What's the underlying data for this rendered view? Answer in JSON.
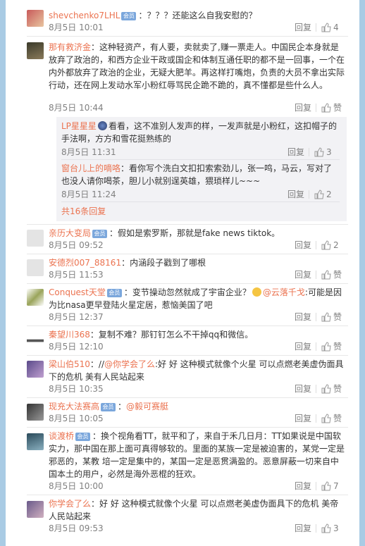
{
  "comments": [
    {
      "name": "shevchenko7LHL",
      "vip": true,
      "text": "：？？？还能这么自我安慰的？",
      "time": "8月5日 10:01",
      "reply": "回复",
      "like": "4"
    },
    {
      "name": "那有救济金",
      "vip": false,
      "text": "：这种轻资产，有人要，卖就卖了,赚一票走人。中国民企本身就是放弃了政治的，和西方企业干政或国企和体制互通任职的都不是一回事，一个在内外都放弃了政治的企业，无疑大肥羊。再这样打嘴炮，负责的大员不拿出实际行动，还在网上发动水军小粉红辱骂民企跪不跪的，真不懂都是些什么人。",
      "time": "8月5日 10:44",
      "reply": "回复",
      "like": "赞"
    },
    {
      "name": "亲历大变局",
      "vip": true,
      "text": "：假如是索罗斯，那就是fake news tiktok。",
      "time": "8月5日 09:52",
      "reply": "回复",
      "like": "2"
    },
    {
      "name": "安德烈007_88161",
      "vip": false,
      "text": "：内涵段子戳到了哪根",
      "time": "8月5日 11:53",
      "reply": "回复",
      "like": "赞"
    },
    {
      "name": "Conquest天堂",
      "vip": true,
      "text_a": "：变节操动忽然就成了宇宙企业？",
      "mention": "@云落千戈",
      "text_b": ":可能是因为比nasa更早登陆火星定居，惹恼美国了吧",
      "time": "8月5日 12:37",
      "reply": "回复",
      "like": "赞"
    },
    {
      "name": "秦望川368",
      "vip": false,
      "text": "：复制不难？那钉钉怎么不干掉qq和微信。",
      "time": "8月5日 12:10",
      "reply": "回复",
      "like": "赞"
    },
    {
      "name": "梁山伯510",
      "vip": false,
      "text_a": "：//",
      "mention": "@你学会了么",
      "text_b": ":好 好 这种模式就像个火星 可以点燃老美虚伪面具下的危机 美有人民站起来",
      "time": "8月5日 10:35",
      "reply": "回复",
      "like": "赞"
    },
    {
      "name": "现充大法赛高",
      "vip": true,
      "text_a": "：",
      "mention": "@毅可赛艇",
      "text_b": "",
      "time": "8月5日 10:05",
      "reply": "回复",
      "like": "赞"
    },
    {
      "name": "谈渡桥",
      "vip": true,
      "text": "：换个视角看TT，就平和了，来自于禾几日月：TT如果说是中国软实力，那中国在那上面可真得够软的。里面的某族一定是被迫害的，某党一定是邪恶的，某教 培一定是集中的，某国一定是恶贯满盈的。恶意屏蔽一切来自中国本土的用户，必然是海外恶棍的狂欢。",
      "time": "8月5日 10:00",
      "reply": "回复",
      "like": "7"
    },
    {
      "name": "你学会了么",
      "vip": false,
      "text": "：好 好 这种模式就像个火星 可以点燃老美虚伪面具下的危机 美帝人民站起来",
      "time": "8月5日 09:53",
      "reply": "回复",
      "like": "3"
    }
  ],
  "sub_replies": [
    {
      "name": "LP星星星",
      "text": "看看，这不准别人发声的样，一发声就是小粉红，这扣帽子的手法啊，方方和雪花挺熟练的",
      "time": "8月5日 11:31",
      "reply": "回复",
      "like": "3"
    },
    {
      "name": "窗台儿上的嘀咯",
      "text": "：看你写个洗白文扣扣索索劲儿，张一鸣，马云，写对了也没人请你喝茶，胆儿小就别逞英雄，猥琐样儿~~~",
      "time": "8月5日 11:24",
      "reply": "回复",
      "like": "2"
    }
  ],
  "sub_more": "共16条回复",
  "vip_label": "会员",
  "colors": {
    "name": "#eb7350",
    "vip": "#7ba7dc",
    "background": "#a9cbe4"
  },
  "icons": [
    "thumb-up-icon",
    "emoji-icon",
    "avatar"
  ]
}
